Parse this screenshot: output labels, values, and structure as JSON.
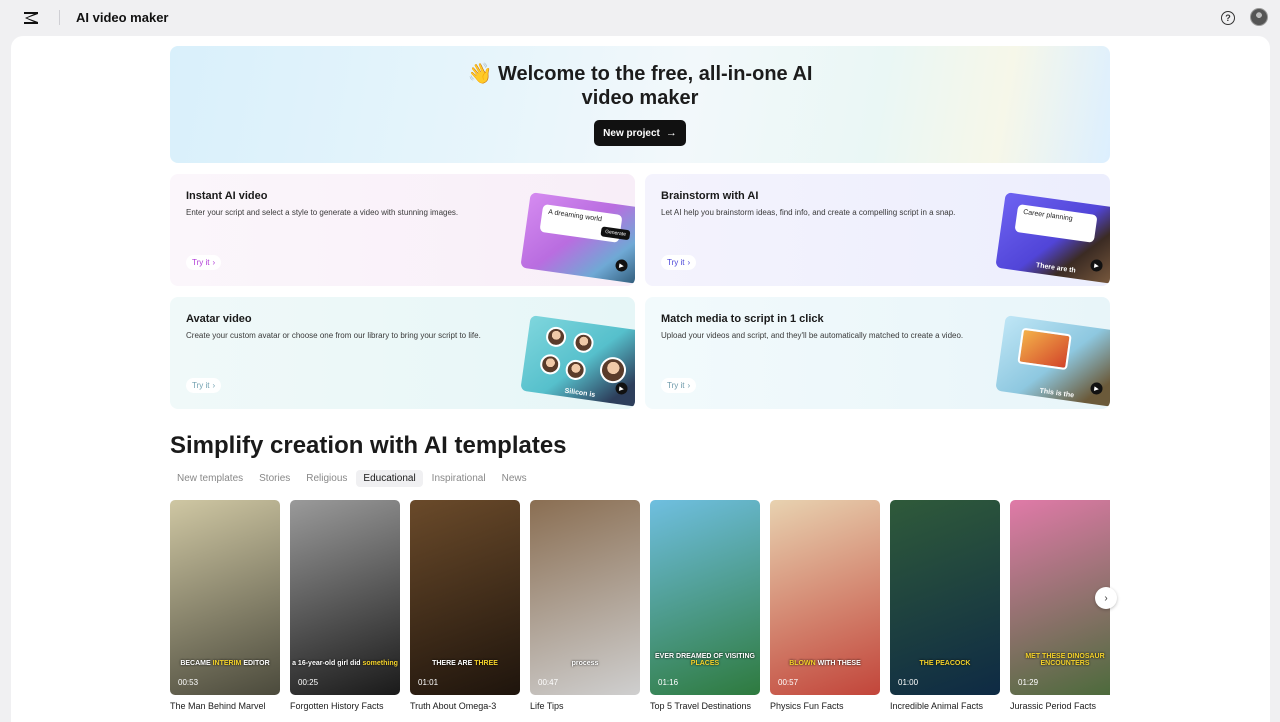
{
  "topbar": {
    "app_title": "AI video maker",
    "help_glyph": "?"
  },
  "hero": {
    "title_line1": "👋 Welcome to the free, all-in-one AI",
    "title_line2": "video maker",
    "new_project_label": "New project",
    "arrow_glyph": "→"
  },
  "cards": [
    {
      "title": "Instant AI video",
      "description": "Enter your script and select a style to generate a video with stunning images.",
      "try_label": "Try it",
      "thumb_label": "A dreaming world",
      "thumb_button": "Generate"
    },
    {
      "title": "Brainstorm with AI",
      "description": "Let AI help you brainstorm ideas, find info, and create a compelling script in a snap.",
      "try_label": "Try it",
      "thumb_label": "Career planning",
      "thumb_caption": "There are th"
    },
    {
      "title": "Avatar video",
      "description": "Create your custom avatar or choose one from our library to bring your script to life.",
      "try_label": "Try it",
      "thumb_caption": "Silicon is"
    },
    {
      "title": "Match media to script in 1 click",
      "description": "Upload your videos and script, and they'll be automatically matched to create a video.",
      "try_label": "Try it",
      "thumb_caption": "This is the"
    }
  ],
  "section_title": "Simplify creation with AI templates",
  "tabs": [
    {
      "label": "New templates",
      "active": false
    },
    {
      "label": "Stories",
      "active": false
    },
    {
      "label": "Religious",
      "active": false
    },
    {
      "label": "Educational",
      "active": true
    },
    {
      "label": "Inspirational",
      "active": false
    },
    {
      "label": "News",
      "active": false
    }
  ],
  "templates": [
    {
      "name": "The Man Behind Marvel",
      "duration": "00:53",
      "caption_pre": "BECAME ",
      "caption_hl": "INTERIM",
      "caption_post": " EDITOR",
      "color1": "#cfc7a3",
      "color2": "#4b4a3c"
    },
    {
      "name": "Forgotten History Facts",
      "duration": "00:25",
      "caption_pre": "a 16-year-old girl did ",
      "caption_hl": "something",
      "caption_post": "",
      "color1": "#9a9a9a",
      "color2": "#1a1a1a"
    },
    {
      "name": "Truth About Omega-3",
      "duration": "01:01",
      "caption_pre": "THERE ARE ",
      "caption_hl": "THREE",
      "caption_post": "",
      "color1": "#6a4a2a",
      "color2": "#1e140c"
    },
    {
      "name": "Life Tips",
      "duration": "00:47",
      "caption_pre": "process",
      "caption_hl": "",
      "caption_post": "",
      "color1": "#8a6e52",
      "color2": "#cfcfcf"
    },
    {
      "name": "Top 5 Travel Destinations",
      "duration": "01:16",
      "caption_pre": "EVER DREAMED OF VISITING ",
      "caption_hl": "PLACES",
      "caption_post": "",
      "color1": "#6fbfe0",
      "color2": "#2e7a3e"
    },
    {
      "name": "Physics Fun Facts",
      "duration": "00:57",
      "caption_pre": "",
      "caption_hl": "BLOWN",
      "caption_post": " WITH THESE",
      "color1": "#e8d2b0",
      "color2": "#c2453a"
    },
    {
      "name": "Incredible Animal Facts",
      "duration": "01:00",
      "caption_pre": "",
      "caption_hl": "THE PEACOCK",
      "caption_post": "",
      "color1": "#2f5a3a",
      "color2": "#0e2a44"
    },
    {
      "name": "Jurassic Period Facts",
      "duration": "01:29",
      "caption_pre": "",
      "caption_hl": "MET THESE DINOSAUR ENCOUNTERS",
      "caption_post": "",
      "color1": "#e07aa8",
      "color2": "#4a6a3a"
    }
  ],
  "next_glyph": "›"
}
